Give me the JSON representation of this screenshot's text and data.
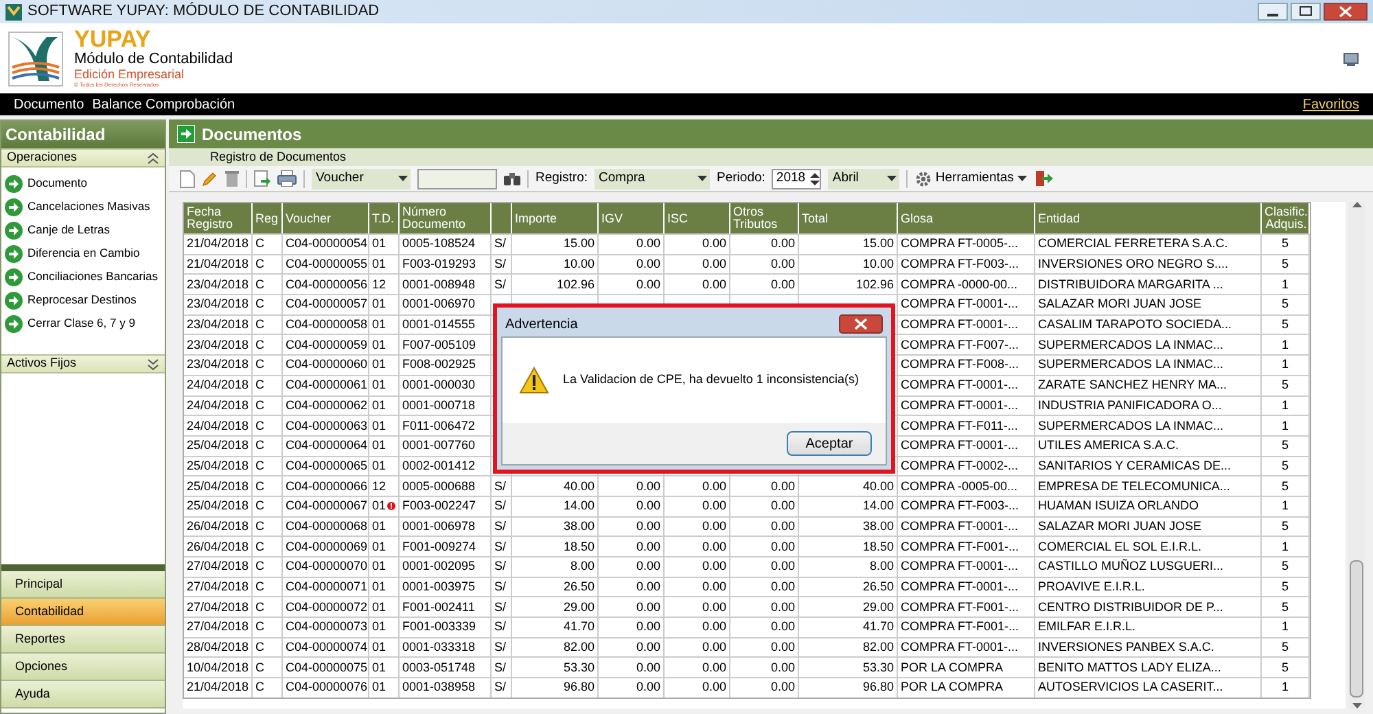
{
  "window": {
    "title": "SOFTWARE YUPAY: MÓDULO DE CONTABILIDAD"
  },
  "brand": {
    "name": "YUPAY",
    "module": "Módulo de Contabilidad",
    "edition": "Edición Empresarial",
    "rights": "© Todos los Derechos Reservados"
  },
  "menu": {
    "items": [
      "Documento",
      "Balance Comprobación"
    ],
    "favorites": "Favoritos"
  },
  "sidebar": {
    "title": "Contabilidad",
    "sections": [
      {
        "label": "Operaciones",
        "expanded": true,
        "items": [
          "Documento",
          "Cancelaciones Masivas",
          "Canje de Letras",
          "Diferencia en Cambio",
          "Conciliaciones Bancarias",
          "Reprocesar Destinos",
          "Cerrar Clase 6, 7 y 9"
        ]
      },
      {
        "label": "Activos Fijos",
        "expanded": false
      }
    ],
    "nav": [
      {
        "label": "Principal",
        "selected": false
      },
      {
        "label": "Contabilidad",
        "selected": true
      },
      {
        "label": "Reportes",
        "selected": false
      },
      {
        "label": "Opciones",
        "selected": false
      },
      {
        "label": "Ayuda",
        "selected": false
      }
    ]
  },
  "page": {
    "title": "Documentos",
    "subtitle": "Registro de Documentos"
  },
  "toolbar": {
    "search_type": "Voucher",
    "registro_label": "Registro:",
    "registro": "Compra",
    "periodo_label": "Periodo:",
    "year": "2018",
    "month": "Abril",
    "tools": "Herramientas"
  },
  "table": {
    "columns": [
      {
        "label": "Fecha Registro",
        "kind": "text"
      },
      {
        "label": "Reg",
        "kind": "text"
      },
      {
        "label": "Voucher",
        "kind": "text"
      },
      {
        "label": "T.D.",
        "kind": "text"
      },
      {
        "label": "Número Documento",
        "kind": "text"
      },
      {
        "kind": "text"
      },
      {
        "label": "Importe",
        "kind": "number"
      },
      {
        "label": "IGV",
        "kind": "number"
      },
      {
        "label": "ISC",
        "kind": "number"
      },
      {
        "label": "Otros Tributos",
        "kind": "number"
      },
      {
        "label": "Total",
        "kind": "number"
      },
      {
        "label": "Glosa",
        "kind": "text"
      },
      {
        "label": "Entidad",
        "kind": "text"
      },
      {
        "label": "Clasific. Adquis.",
        "kind": "center"
      }
    ],
    "rows": [
      {
        "flagged": false,
        "cells": [
          "21/04/2018",
          "C",
          "C04-00000054",
          "01",
          "0005-108524",
          "S/",
          "15.00",
          "0.00",
          "0.00",
          "0.00",
          "15.00",
          "COMPRA FT-0005-...",
          "COMERCIAL FERRETERA S.A.C.",
          "5"
        ]
      },
      {
        "flagged": false,
        "cells": [
          "21/04/2018",
          "C",
          "C04-00000055",
          "01",
          "F003-019293",
          "S/",
          "10.00",
          "0.00",
          "0.00",
          "0.00",
          "10.00",
          "COMPRA FT-F003-...",
          "INVERSIONES ORO NEGRO S....",
          "5"
        ]
      },
      {
        "flagged": false,
        "cells": [
          "23/04/2018",
          "C",
          "C04-00000056",
          "12",
          "0001-008948",
          "S/",
          "102.96",
          "0.00",
          "0.00",
          "0.00",
          "102.96",
          "COMPRA -0000-00...",
          "DISTRIBUIDORA MARGARITA ...",
          "1"
        ]
      },
      {
        "flagged": false,
        "cells": [
          "23/04/2018",
          "C",
          "C04-00000057",
          "01",
          "0001-006970",
          null,
          null,
          null,
          null,
          null,
          null,
          "COMPRA FT-0001-...",
          "SALAZAR MORI JUAN JOSE",
          "5"
        ]
      },
      {
        "flagged": false,
        "cells": [
          "23/04/2018",
          "C",
          "C04-00000058",
          "01",
          "0001-014555",
          null,
          null,
          null,
          null,
          null,
          null,
          "COMPRA FT-0001-...",
          "CASALIM TARAPOTO SOCIEDA...",
          "5"
        ]
      },
      {
        "flagged": false,
        "cells": [
          "23/04/2018",
          "C",
          "C04-00000059",
          "01",
          "F007-005109",
          null,
          null,
          null,
          null,
          null,
          null,
          "COMPRA FT-F007-...",
          "SUPERMERCADOS LA INMAC...",
          "1"
        ]
      },
      {
        "flagged": false,
        "cells": [
          "23/04/2018",
          "C",
          "C04-00000060",
          "01",
          "F008-002925",
          null,
          null,
          null,
          null,
          null,
          null,
          "COMPRA FT-F008-...",
          "SUPERMERCADOS LA INMAC...",
          "1"
        ]
      },
      {
        "flagged": false,
        "cells": [
          "24/04/2018",
          "C",
          "C04-00000061",
          "01",
          "0001-000030",
          null,
          null,
          null,
          null,
          null,
          null,
          "COMPRA FT-0001-...",
          "ZARATE SANCHEZ HENRY MA...",
          "5"
        ]
      },
      {
        "flagged": false,
        "cells": [
          "24/04/2018",
          "C",
          "C04-00000062",
          "01",
          "0001-000718",
          null,
          null,
          null,
          null,
          null,
          null,
          "COMPRA FT-0001-...",
          "INDUSTRIA PANIFICADORA O...",
          "1"
        ]
      },
      {
        "flagged": false,
        "cells": [
          "24/04/2018",
          "C",
          "C04-00000063",
          "01",
          "F011-006472",
          null,
          null,
          null,
          null,
          null,
          null,
          "COMPRA FT-F011-...",
          "SUPERMERCADOS LA INMAC...",
          "1"
        ]
      },
      {
        "flagged": false,
        "cells": [
          "25/04/2018",
          "C",
          "C04-00000064",
          "01",
          "0001-007760",
          null,
          null,
          null,
          null,
          null,
          null,
          "COMPRA FT-0001-...",
          "UTILES AMERICA S.A.C.",
          "5"
        ]
      },
      {
        "flagged": false,
        "cells": [
          "25/04/2018",
          "C",
          "C04-00000065",
          "01",
          "0002-001412",
          null,
          null,
          null,
          null,
          null,
          null,
          "COMPRA FT-0002-...",
          "SANITARIOS Y CERAMICAS DE...",
          "5"
        ]
      },
      {
        "flagged": false,
        "cells": [
          "25/04/2018",
          "C",
          "C04-00000066",
          "12",
          "0005-000688",
          "S/",
          "40.00",
          "0.00",
          "0.00",
          "0.00",
          "40.00",
          "COMPRA -0005-00...",
          "EMPRESA DE TELECOMUNICA...",
          "5"
        ]
      },
      {
        "flagged": true,
        "cells": [
          "25/04/2018",
          "C",
          "C04-00000067",
          "01",
          "F003-002247",
          "S/",
          "14.00",
          "0.00",
          "0.00",
          "0.00",
          "14.00",
          "COMPRA FT-F003-...",
          "HUAMAN ISUIZA ORLANDO",
          "1"
        ]
      },
      {
        "flagged": false,
        "cells": [
          "26/04/2018",
          "C",
          "C04-00000068",
          "01",
          "0001-006978",
          "S/",
          "38.00",
          "0.00",
          "0.00",
          "0.00",
          "38.00",
          "COMPRA FT-0001-...",
          "SALAZAR MORI JUAN JOSE",
          "5"
        ]
      },
      {
        "flagged": false,
        "cells": [
          "26/04/2018",
          "C",
          "C04-00000069",
          "01",
          "F001-009274",
          "S/",
          "18.50",
          "0.00",
          "0.00",
          "0.00",
          "18.50",
          "COMPRA FT-F001-...",
          "COMERCIAL EL SOL E.I.R.L.",
          "1"
        ]
      },
      {
        "flagged": false,
        "cells": [
          "27/04/2018",
          "C",
          "C04-00000070",
          "01",
          "0001-002095",
          "S/",
          "8.00",
          "0.00",
          "0.00",
          "0.00",
          "8.00",
          "COMPRA FT-0001-...",
          "CASTILLO MUÑOZ LUSGUERI...",
          "5"
        ]
      },
      {
        "flagged": false,
        "cells": [
          "27/04/2018",
          "C",
          "C04-00000071",
          "01",
          "0001-003975",
          "S/",
          "26.50",
          "0.00",
          "0.00",
          "0.00",
          "26.50",
          "COMPRA FT-0001-...",
          "PROAVIVE E.I.R.L.",
          "5"
        ]
      },
      {
        "flagged": false,
        "cells": [
          "27/04/2018",
          "C",
          "C04-00000072",
          "01",
          "F001-002411",
          "S/",
          "29.00",
          "0.00",
          "0.00",
          "0.00",
          "29.00",
          "COMPRA FT-F001-...",
          "CENTRO DISTRIBUIDOR DE P...",
          "5"
        ]
      },
      {
        "flagged": false,
        "cells": [
          "27/04/2018",
          "C",
          "C04-00000073",
          "01",
          "F001-003339",
          "S/",
          "41.70",
          "0.00",
          "0.00",
          "0.00",
          "41.70",
          "COMPRA FT-F001-...",
          "EMILFAR E.I.R.L.",
          "1"
        ]
      },
      {
        "flagged": false,
        "cells": [
          "28/04/2018",
          "C",
          "C04-00000074",
          "01",
          "0001-033318",
          "S/",
          "82.00",
          "0.00",
          "0.00",
          "0.00",
          "82.00",
          "COMPRA FT-0001-...",
          "INVERSIONES PANBEX S.A.C.",
          "5"
        ]
      },
      {
        "flagged": false,
        "cells": [
          "10/04/2018",
          "C",
          "C04-00000075",
          "01",
          "0003-051748",
          "S/",
          "53.30",
          "0.00",
          "0.00",
          "0.00",
          "53.30",
          "POR LA COMPRA",
          "BENITO MATTOS LADY ELIZA...",
          "5"
        ]
      },
      {
        "flagged": false,
        "cells": [
          "21/04/2018",
          "C",
          "C04-00000076",
          "01",
          "0001-038958",
          "S/",
          "96.80",
          "0.00",
          "0.00",
          "0.00",
          "96.80",
          "POR LA COMPRA",
          "AUTOSERVICIOS LA CASERIT...",
          "1"
        ]
      }
    ]
  },
  "dialog": {
    "title": "Advertencia",
    "message": "La Validacion de CPE, ha devuelto 1 inconsistencia(s)",
    "button": "Aceptar"
  }
}
